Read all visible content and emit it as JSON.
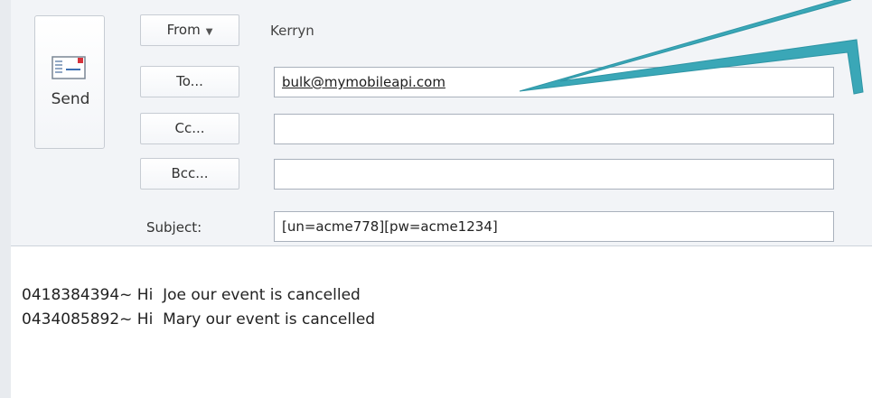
{
  "compose": {
    "send_label": "Send",
    "from_label": "From",
    "from_value": "Kerryn",
    "to_label": "To...",
    "to_value": "bulk@mymobileapi.com",
    "cc_label": "Cc...",
    "cc_value": "",
    "bcc_label": "Bcc...",
    "bcc_value": "",
    "subject_label": "Subject:",
    "subject_value": "[un=acme778][pw=acme1234]"
  },
  "body": {
    "lines": [
      "0418384394~ Hi  Joe our event is cancelled",
      "0434085892~ Hi  Mary our event is cancelled"
    ]
  },
  "colors": {
    "callout_arrow": "#3aa7b7"
  }
}
